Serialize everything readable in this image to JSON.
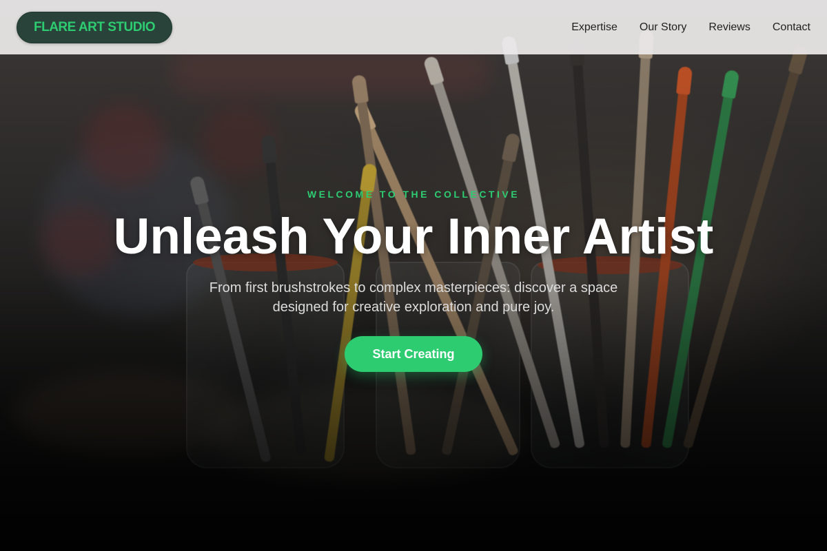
{
  "nav": {
    "logo": "FLARE ART STUDIO",
    "links": [
      "Expertise",
      "Our Story",
      "Reviews",
      "Contact"
    ]
  },
  "hero": {
    "eyebrow": "WELCOME TO THE COLLECTIVE",
    "headline": "Unleash Your Inner Artist",
    "subtitle": "From first brushstrokes to complex masterpieces: discover a space designed for creative exploration and pure joy.",
    "cta_label": "Start Creating"
  },
  "colors": {
    "accent": "#2ecc71",
    "logo_bg": "#29433a",
    "nav_bg": "#eceaea"
  }
}
